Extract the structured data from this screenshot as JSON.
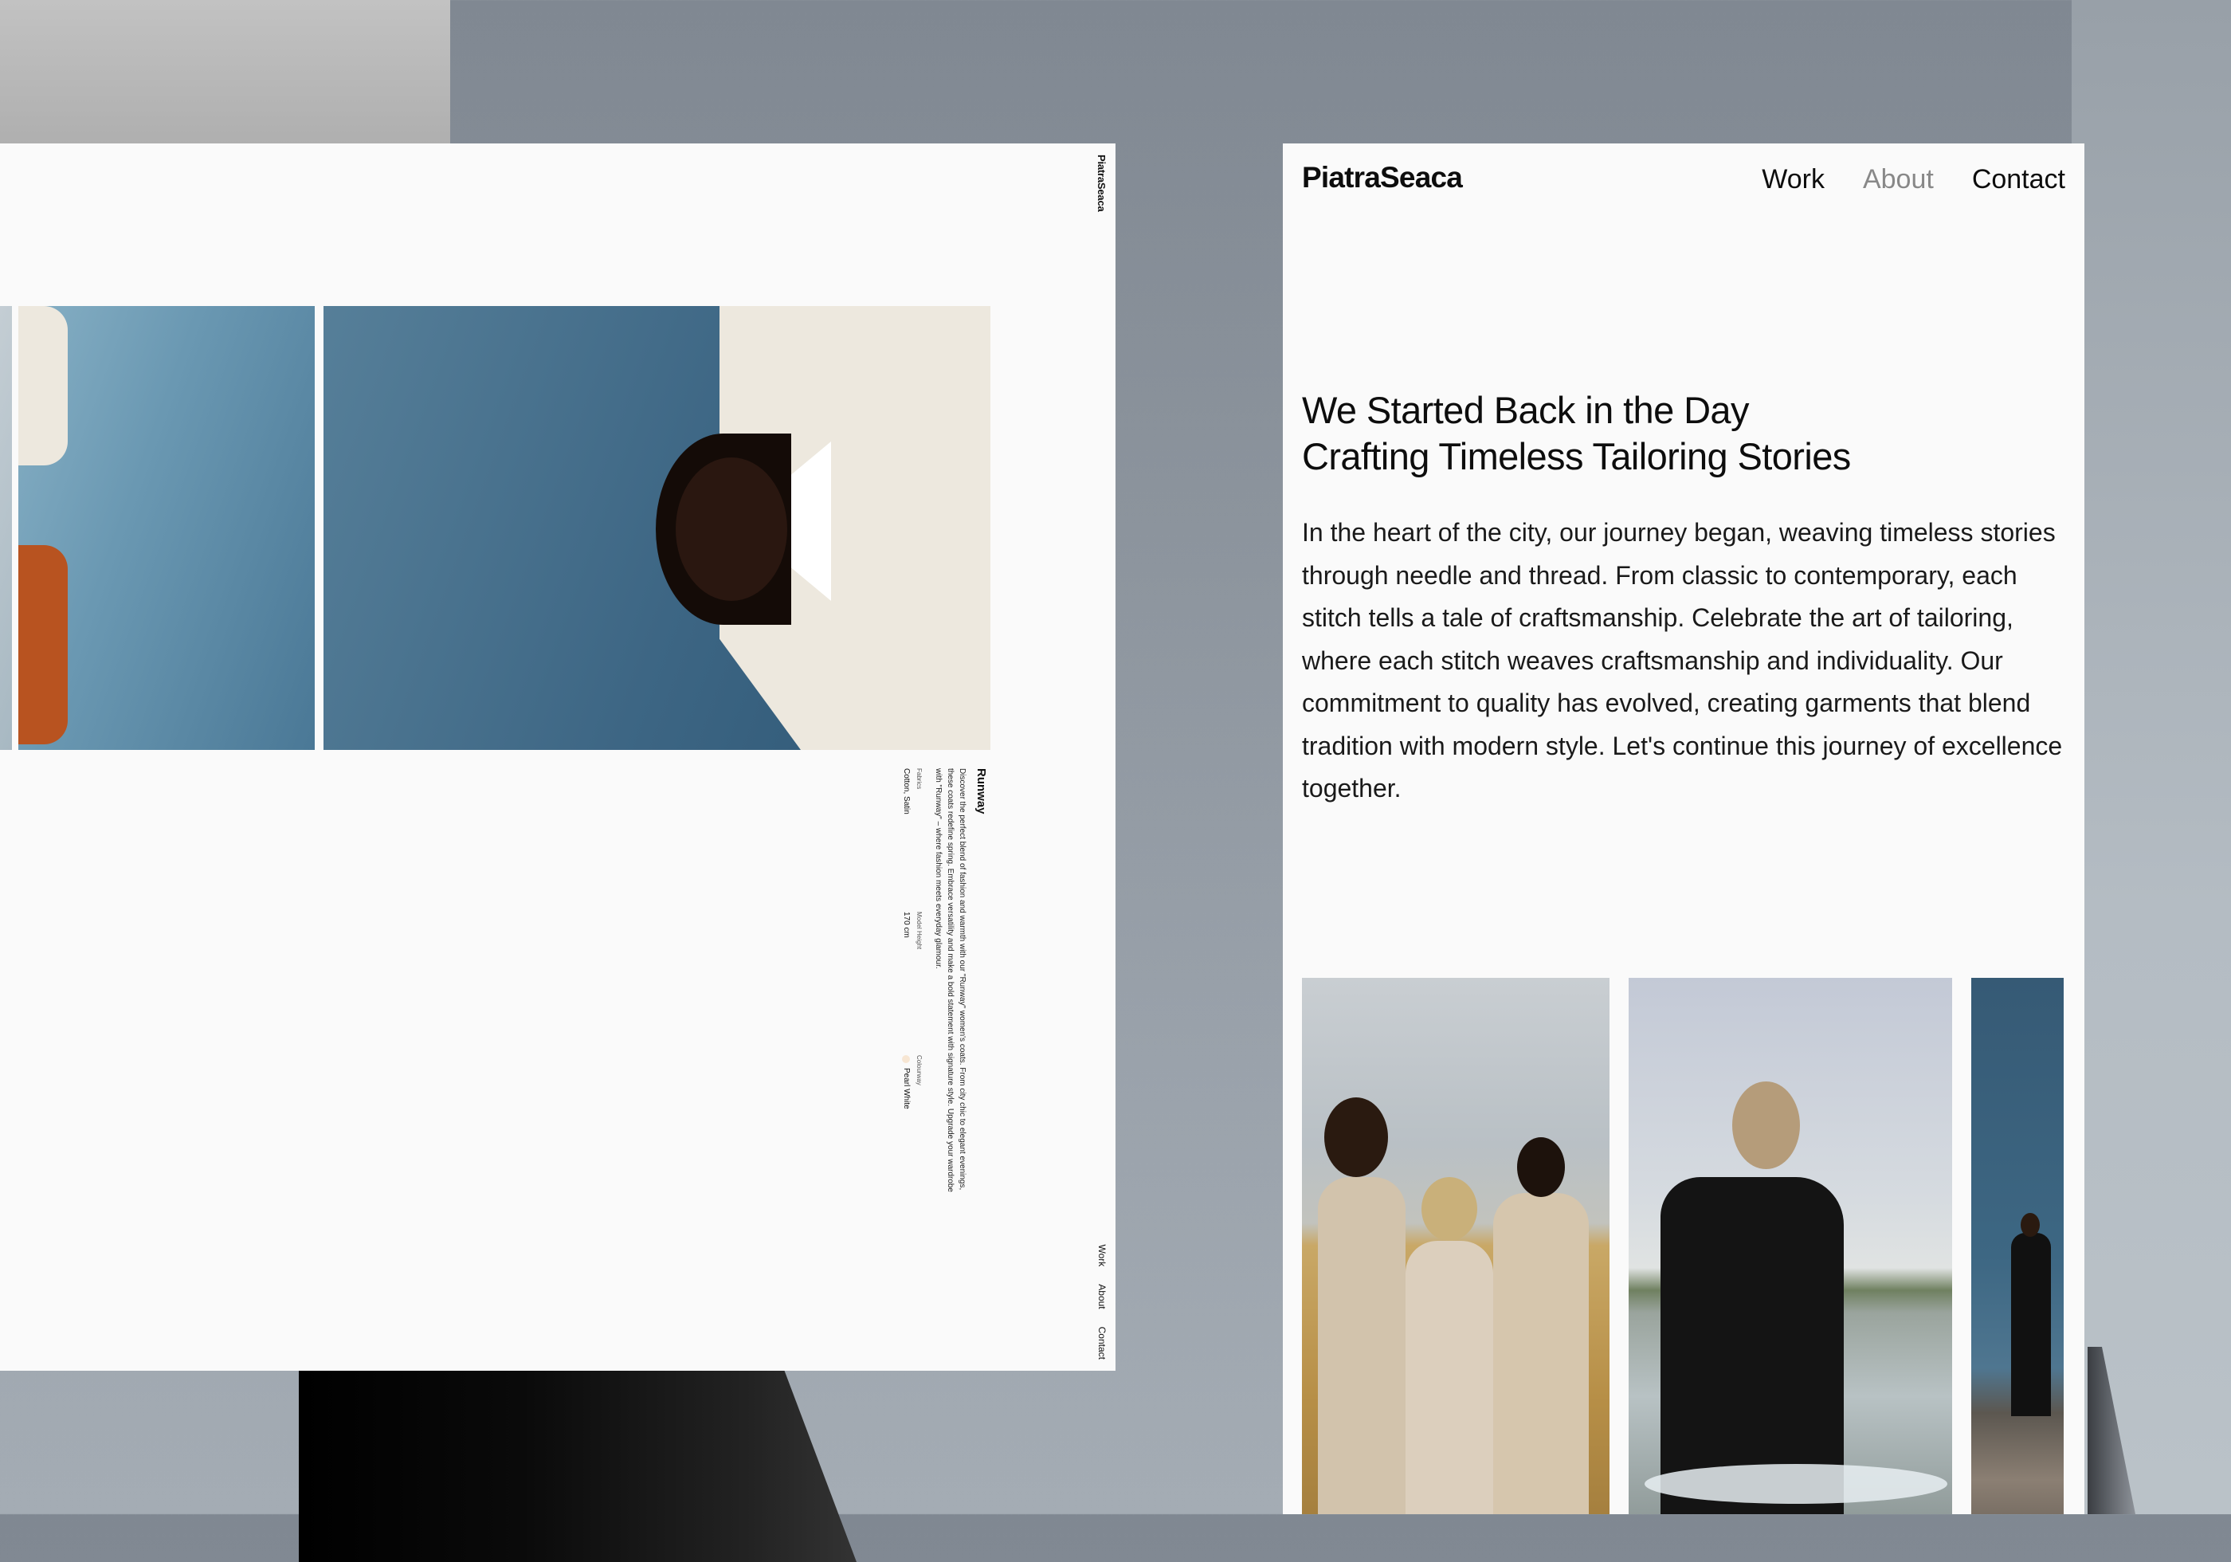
{
  "brand": "PiatraSeaca",
  "nav": [
    {
      "label": "Work",
      "active": false
    },
    {
      "label": "About",
      "active": true
    },
    {
      "label": "Contact",
      "active": false
    }
  ],
  "colors": {
    "page_bg": "#fafafa",
    "text": "#0d0d0d",
    "nav_active": "#888888",
    "swatch_pearl_white": "#f7e6d3"
  },
  "work_page": {
    "brand": "PiatraSeaca",
    "nav": [
      "Work",
      "About",
      "Contact"
    ],
    "product": {
      "title": "Runway",
      "description": "Discover the perfect blend of fashion and warmth with our \"Runway\" women's coats. From city chic to elegant evenings, these coats redefine spring. Embrace versatility and make a bold statement with signature style. Upgrade your wardrobe with \"Runway\" – where fashion meets everyday glamour.",
      "specs": [
        {
          "label": "Fabrics",
          "value": "Cotton, Satin"
        },
        {
          "label": "Model Height",
          "value": "170 cm"
        },
        {
          "label": "Colourway",
          "value": "Pearl White",
          "swatch": true
        }
      ]
    },
    "images": [
      {
        "alt": "Model in pearl white coat against blue sky"
      },
      {
        "alt": "Two models in orange and white coats against blue sky"
      },
      {
        "alt": "Partially visible image"
      }
    ]
  },
  "about_page": {
    "heading_lines": [
      "We Started Back in the Day",
      "Crafting Timeless Tailoring Stories"
    ],
    "body": "In the heart of the city, our journey began, weaving timeless stories through needle and thread. From classic to contemporary, each stitch tells a tale of craftsmanship. Celebrate the art of tailoring, where each stitch weaves craftsmanship and individuality. Our commitment to quality has evolved, creating garments that blend tradition with modern style. Let's continue this journey of excellence together.",
    "images": [
      {
        "alt": "Three models in beige suits in a wheat field"
      },
      {
        "alt": "Model in black suit standing in a lake"
      },
      {
        "alt": "Model in black suit standing on rocks against blue sky"
      }
    ]
  }
}
